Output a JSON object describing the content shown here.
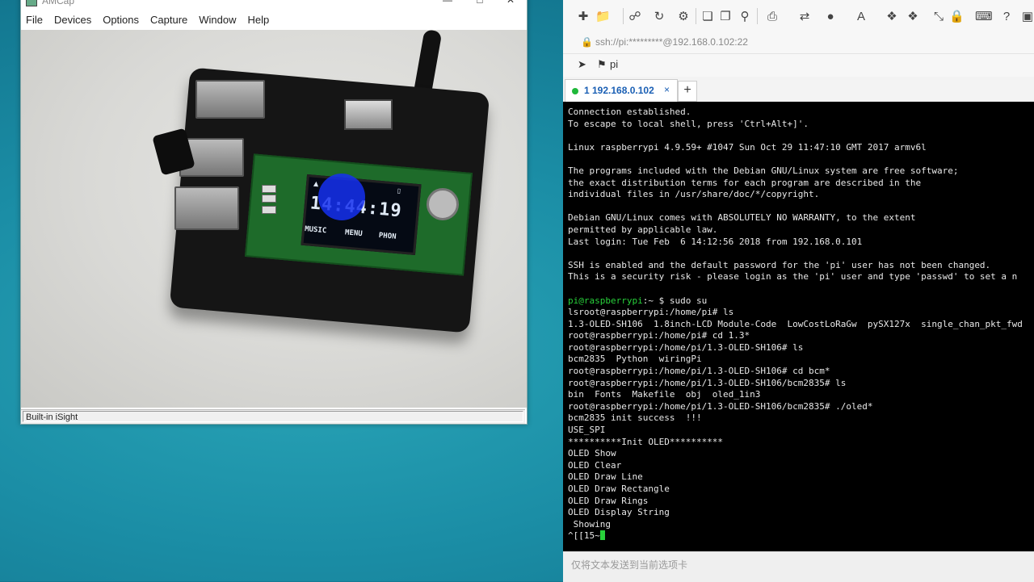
{
  "amcap": {
    "title": "AMCap",
    "menu": [
      "File",
      "Devices",
      "Options",
      "Capture",
      "Window",
      "Help"
    ],
    "status": "Built-in iSight",
    "oled": {
      "clock": "14:44:19",
      "menu": [
        "MUSIC",
        "MENU",
        "PHON"
      ]
    }
  },
  "terminal": {
    "address": "ssh://pi:*********@192.168.0.102:22",
    "session": "pi",
    "tab_label": "1 192.168.0.102",
    "tab_close": "×",
    "new_tab": "+",
    "send_placeholder": "仅将文本发送到当前选项卡",
    "lines": [
      "Connection established.",
      "To escape to local shell, press 'Ctrl+Alt+]'.",
      "",
      "Linux raspberrypi 4.9.59+ #1047 Sun Oct 29 11:47:10 GMT 2017 armv6l",
      "",
      "The programs included with the Debian GNU/Linux system are free software;",
      "the exact distribution terms for each program are described in the",
      "individual files in /usr/share/doc/*/copyright.",
      "",
      "Debian GNU/Linux comes with ABSOLUTELY NO WARRANTY, to the extent",
      "permitted by applicable law.",
      "Last login: Tue Feb  6 14:12:56 2018 from 192.168.0.101",
      "",
      "SSH is enabled and the default password for the 'pi' user has not been changed.",
      "This is a security risk - please login as the 'pi' user and type 'passwd' to set a n",
      "",
      "pi@raspberrypi:~ $ sudo su",
      "lsroot@raspberrypi:/home/pi# ls",
      "1.3-OLED-SH106  1.8inch-LCD Module-Code  LowCostLoRaGw  pySX127x  single_chan_pkt_fwd",
      "root@raspberrypi:/home/pi# cd 1.3*",
      "root@raspberrypi:/home/pi/1.3-OLED-SH106# ls",
      "bcm2835  Python  wiringPi",
      "root@raspberrypi:/home/pi/1.3-OLED-SH106# cd bcm*",
      "root@raspberrypi:/home/pi/1.3-OLED-SH106/bcm2835# ls",
      "bin  Fonts  Makefile  obj  oled_1in3",
      "root@raspberrypi:/home/pi/1.3-OLED-SH106/bcm2835# ./oled*",
      "bcm2835 init success  !!!",
      "USE_SPI",
      "**********Init OLED**********",
      "OLED Show",
      "OLED Clear",
      "OLED Draw Line",
      "OLED Draw Rectangle",
      "OLED Draw Rings",
      "OLED Display String",
      " Showing",
      "^[[15~"
    ],
    "prompt_user": "pi@raspberrypi",
    "prompt_rest": ":~ $ sudo su"
  },
  "colors": {
    "prompt_green": "#28d13a",
    "tab_blue": "#1a5fb4",
    "desktop": "#1b8ea6"
  },
  "icons": [
    "new-session-icon",
    "open-folder-icon",
    "link-icon",
    "properties-icon",
    "copy-icon",
    "paste-icon",
    "find-icon",
    "print-icon",
    "globe-icon",
    "font-icon",
    "help-icon",
    "lock-icon",
    "bookmark-icon",
    "send-icon"
  ]
}
